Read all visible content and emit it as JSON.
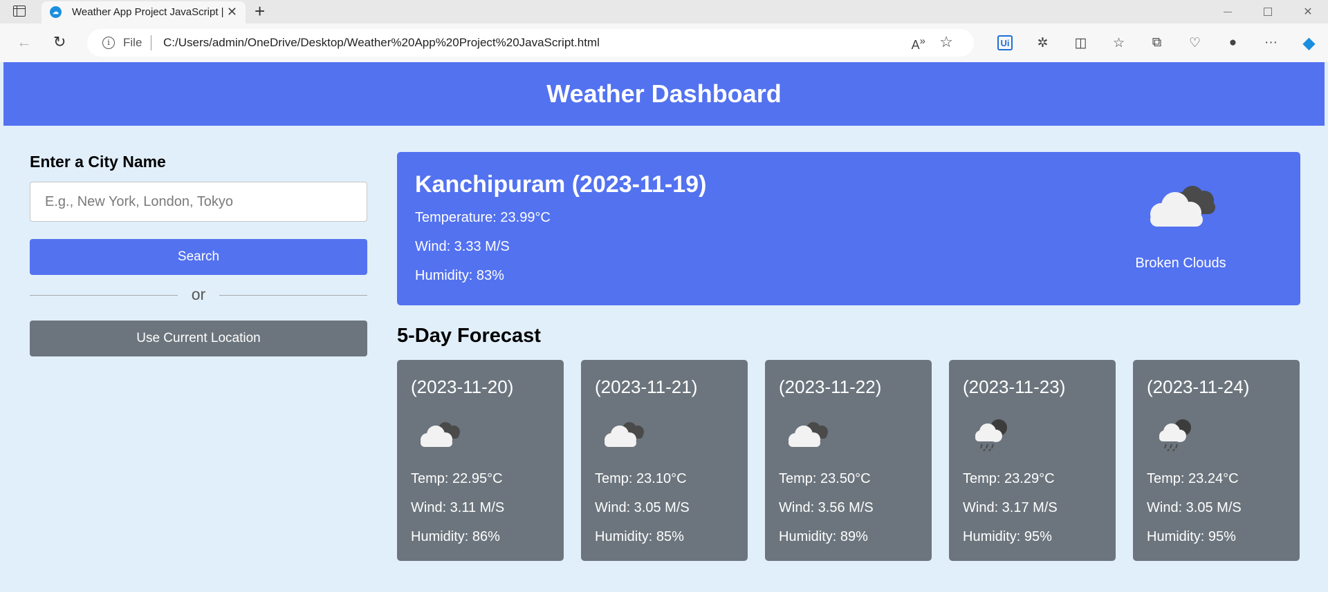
{
  "browser": {
    "tab_title": "Weather App Project JavaScript |",
    "tab_favicon": "weather-app-favicon",
    "url_scheme": "File",
    "url": "C:/Users/admin/OneDrive/Desktop/Weather%20App%20Project%20JavaScript.html"
  },
  "header": {
    "title": "Weather Dashboard"
  },
  "sidebar": {
    "label": "Enter a City Name",
    "input_placeholder": "E.g., New York, London, Tokyo",
    "search_label": "Search",
    "or_label": "or",
    "location_label": "Use Current Location"
  },
  "current": {
    "title": "Kanchipuram (2023-11-19)",
    "temperature": "Temperature: 23.99°C",
    "wind": "Wind: 3.33 M/S",
    "humidity": "Humidity: 83%",
    "description": "Broken Clouds",
    "icon": "broken-clouds-icon"
  },
  "forecast": {
    "title": "5-Day Forecast",
    "days": [
      {
        "date": "(2023-11-20)",
        "temp": "Temp: 22.95°C",
        "wind": "Wind: 3.11 M/S",
        "humidity": "Humidity: 86%",
        "icon": "broken-clouds-icon"
      },
      {
        "date": "(2023-11-21)",
        "temp": "Temp: 23.10°C",
        "wind": "Wind: 3.05 M/S",
        "humidity": "Humidity: 85%",
        "icon": "broken-clouds-icon"
      },
      {
        "date": "(2023-11-22)",
        "temp": "Temp: 23.50°C",
        "wind": "Wind: 3.56 M/S",
        "humidity": "Humidity: 89%",
        "icon": "broken-clouds-icon"
      },
      {
        "date": "(2023-11-23)",
        "temp": "Temp: 23.29°C",
        "wind": "Wind: 3.17 M/S",
        "humidity": "Humidity: 95%",
        "icon": "rain-icon"
      },
      {
        "date": "(2023-11-24)",
        "temp": "Temp: 23.24°C",
        "wind": "Wind: 3.05 M/S",
        "humidity": "Humidity: 95%",
        "icon": "rain-icon"
      }
    ]
  },
  "colors": {
    "accent": "#5372f0",
    "card": "#6c757d",
    "page_bg": "#e1effa"
  }
}
